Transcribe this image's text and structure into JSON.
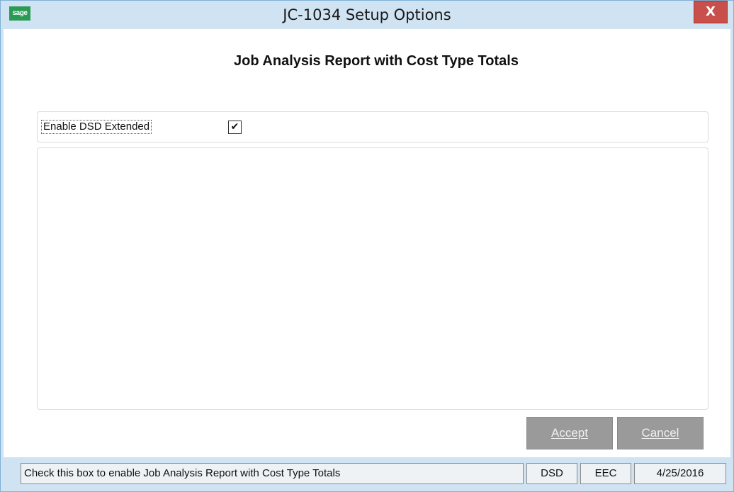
{
  "window": {
    "title": "JC-1034 Setup Options",
    "app_icon_text": "sage",
    "close_glyph": "X"
  },
  "main": {
    "heading": "Job Analysis Report with Cost Type Totals",
    "options": {
      "enable_dsd_extended_label": "Enable DSD Extended",
      "enable_dsd_extended_checked": true,
      "checkmark_glyph": "✔"
    }
  },
  "buttons": {
    "accept_label": "Accept",
    "cancel_label": "Cancel"
  },
  "status_bar": {
    "message": "Check this box to enable Job Analysis Report with Cost Type Totals",
    "module": "DSD",
    "company": "EEC",
    "date": "4/25/2016"
  },
  "colors": {
    "chrome": "#cfe3f3",
    "close_button": "#c9504a",
    "disabled_button": "#9a9a9a",
    "app_icon": "#2a9a55"
  }
}
